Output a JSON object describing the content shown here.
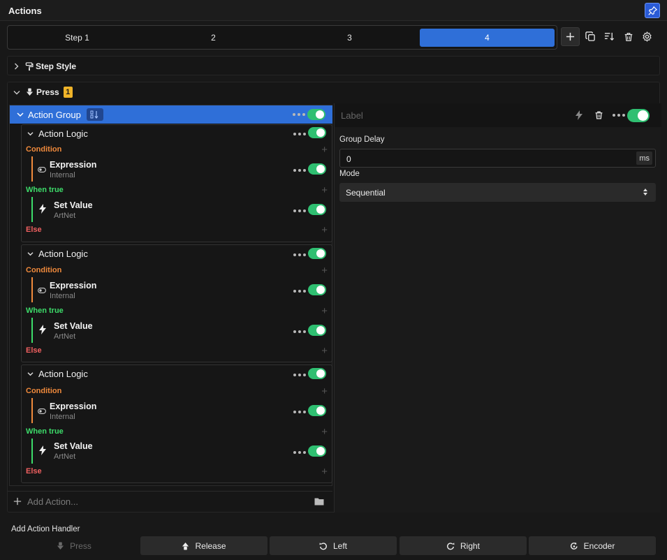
{
  "window": {
    "title": "Actions"
  },
  "steps": {
    "tabs": [
      "Step 1",
      "2",
      "3",
      "4"
    ],
    "active_index": 3
  },
  "sections": {
    "step_style": "Step Style",
    "press": "Press",
    "press_count": "1"
  },
  "action_group": {
    "label": "Action Group",
    "enabled": true
  },
  "logic_blocks": [
    {
      "title": "Action Logic",
      "condition_label": "Condition",
      "condition_item": {
        "title": "Expression",
        "subtitle": "Internal"
      },
      "when_true_label": "When true",
      "action_item": {
        "title": "Set Value",
        "subtitle": "ArtNet"
      },
      "else_label": "Else"
    },
    {
      "title": "Action Logic",
      "condition_label": "Condition",
      "condition_item": {
        "title": "Expression",
        "subtitle": "Internal"
      },
      "when_true_label": "When true",
      "action_item": {
        "title": "Set Value",
        "subtitle": "ArtNet"
      },
      "else_label": "Else"
    },
    {
      "title": "Action Logic",
      "condition_label": "Condition",
      "condition_item": {
        "title": "Expression",
        "subtitle": "Internal"
      },
      "when_true_label": "When true",
      "action_item": {
        "title": "Set Value",
        "subtitle": "ArtNet"
      },
      "else_label": "Else"
    }
  ],
  "add_action": {
    "placeholder": "Add Action..."
  },
  "detail": {
    "label_placeholder": "Label",
    "group_delay_label": "Group Delay",
    "group_delay_value": "0",
    "group_delay_unit": "ms",
    "mode_label": "Mode",
    "mode_value": "Sequential"
  },
  "handlers": {
    "title": "Add Action Handler",
    "buttons": [
      "Press",
      "Release",
      "Left",
      "Right",
      "Encoder"
    ]
  },
  "colors": {
    "accent": "#2f6fd8",
    "toggle_on": "#2fbf71",
    "condition": "#f08a3c",
    "when_true": "#3ddc6a",
    "else": "#f06060",
    "badge": "#f0b429"
  },
  "icons": [
    "pin-icon",
    "plus-icon",
    "copy-icon",
    "sort-icon",
    "trash-icon",
    "gear-icon",
    "chevron-right-icon",
    "chevron-down-icon",
    "paint-roller-icon",
    "press-down-icon",
    "sort-numeric-icon",
    "more-dots-icon",
    "toggle-switch-icon",
    "lightning-icon",
    "folder-icon",
    "release-up-icon",
    "rotate-left-icon",
    "rotate-right-icon",
    "encoder-icon"
  ]
}
